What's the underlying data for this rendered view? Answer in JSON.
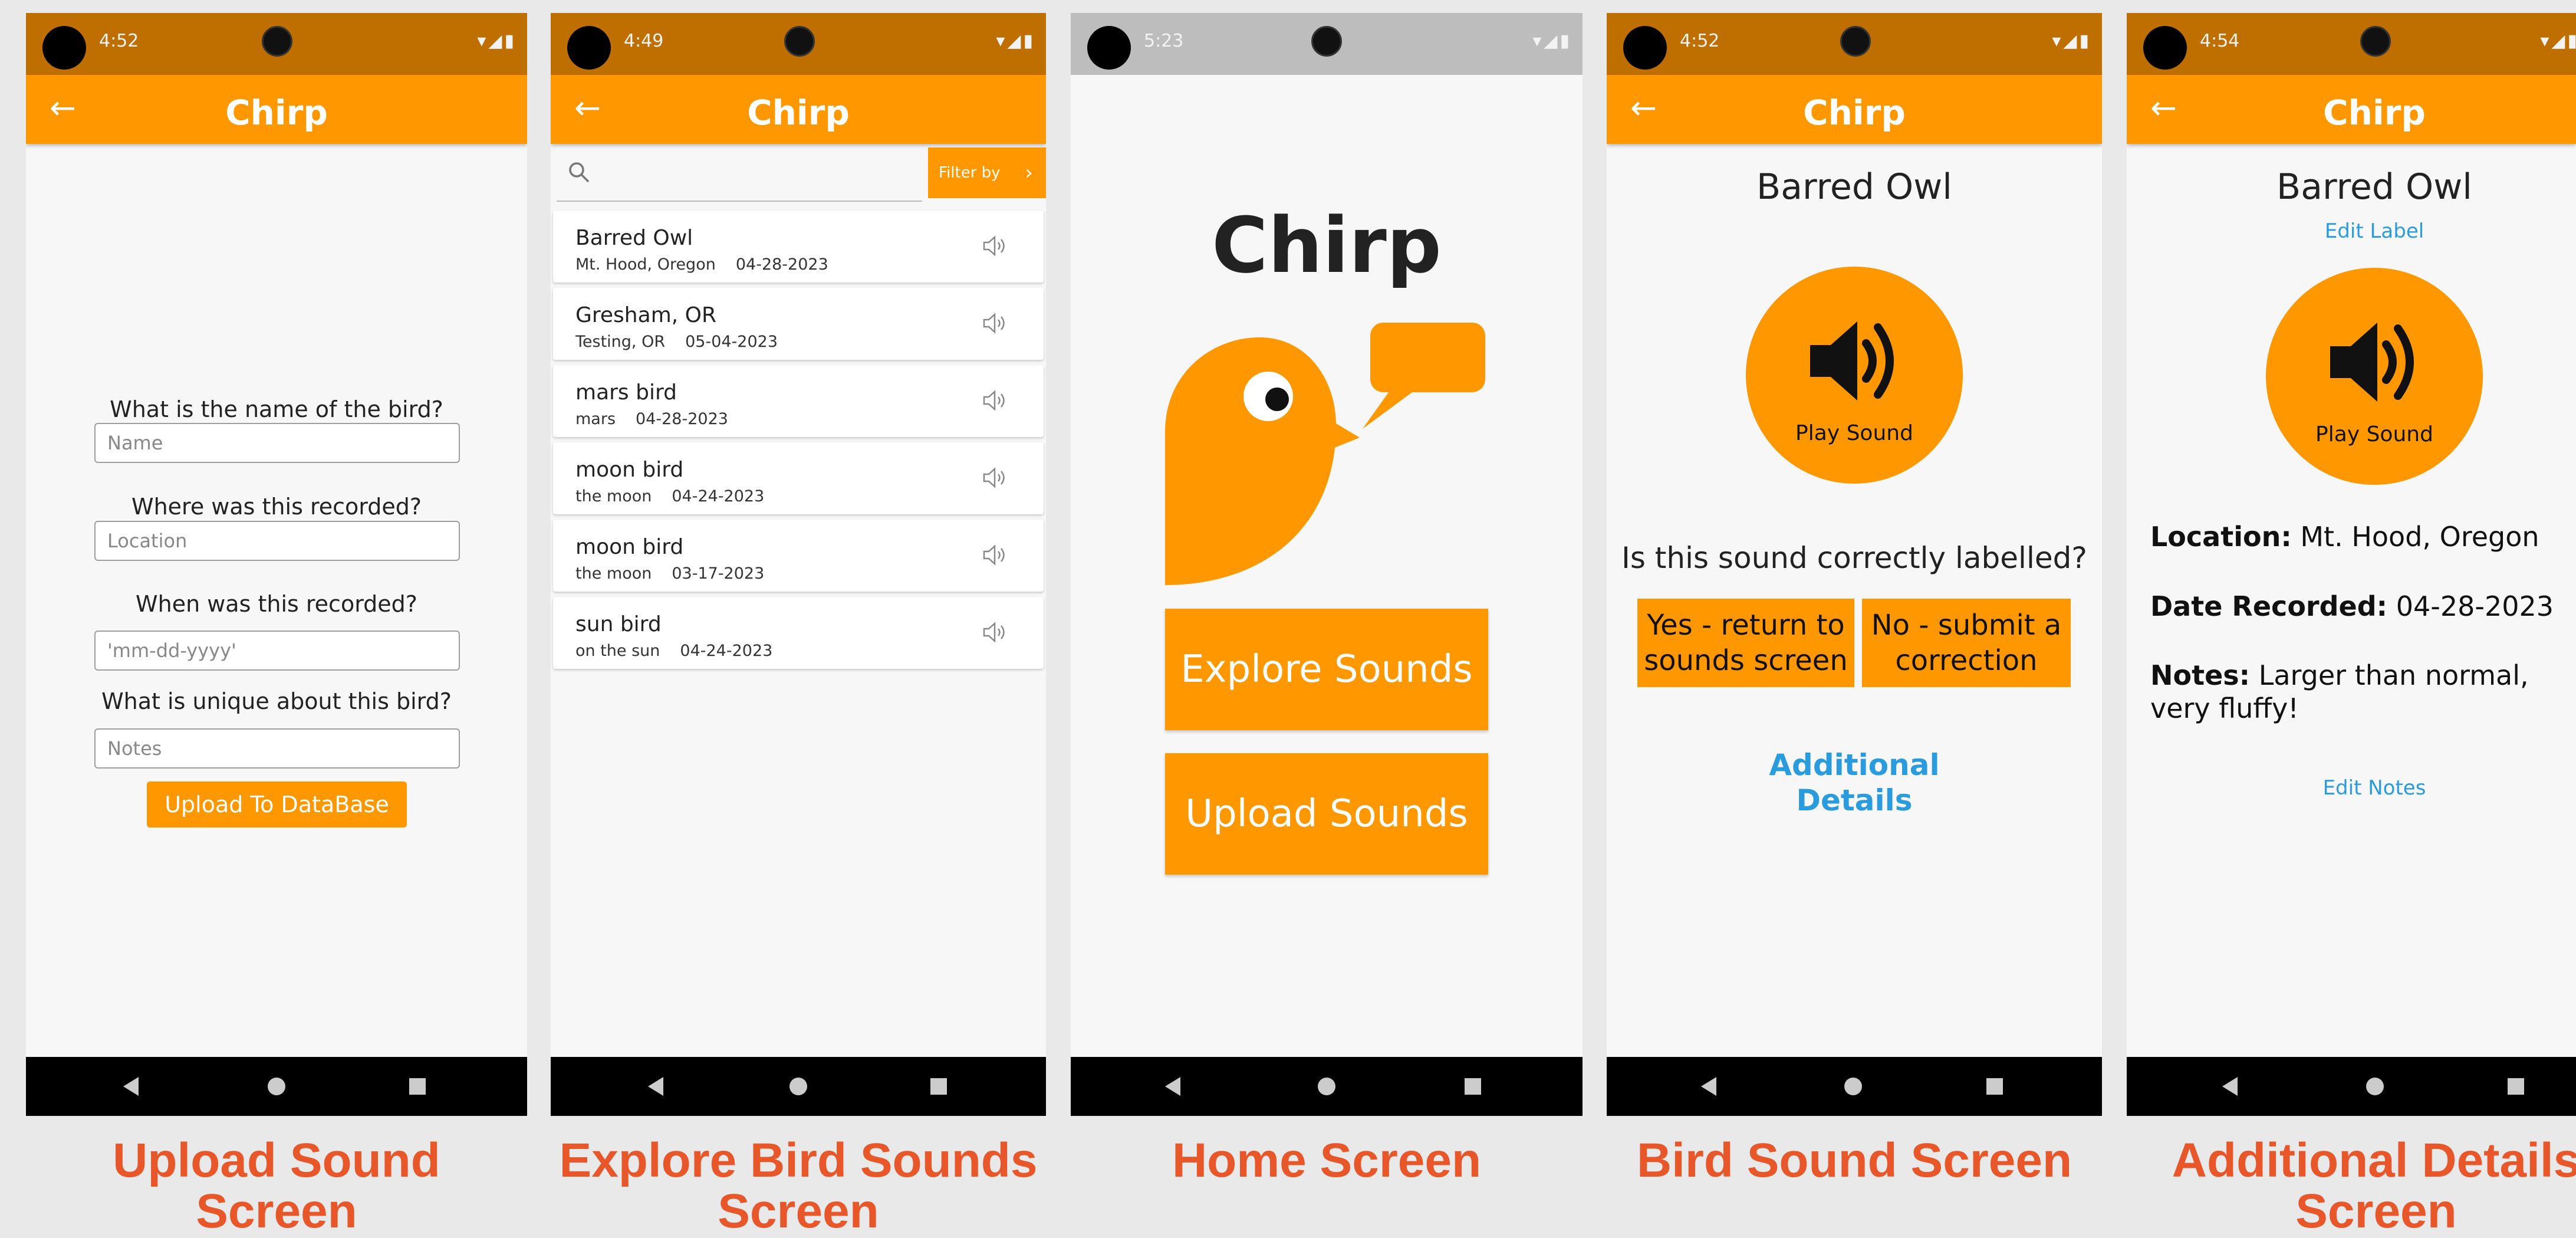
{
  "app": {
    "title": "Chirp",
    "back_glyph": "←",
    "accent_color": "#ff9800",
    "status_color": "#bf6f00",
    "link_color": "#2a9cdd",
    "caption_color": "#e8572a"
  },
  "screens": {
    "upload": {
      "time": "4:52",
      "questions": {
        "name": "What is the name of the bird?",
        "location": "Where was this recorded?",
        "date": "When was this recorded?",
        "unique": "What is unique about this bird?"
      },
      "placeholders": {
        "name": "Name",
        "location": "Location",
        "date": "'mm-dd-yyyy'",
        "notes": "Notes"
      },
      "submit_label": "Upload To DataBase",
      "caption_line1": "Upload Sound",
      "caption_line2": "Screen"
    },
    "explore": {
      "time": "4:49",
      "filter_label": "Filter by",
      "items": [
        {
          "title": "Barred Owl",
          "location": "Mt. Hood, Oregon",
          "date": "04-28-2023"
        },
        {
          "title": "Gresham, OR",
          "location": "Testing, OR",
          "date": "05-04-2023"
        },
        {
          "title": "mars bird",
          "location": "mars",
          "date": "04-28-2023"
        },
        {
          "title": "moon bird",
          "location": "the moon",
          "date": "04-24-2023"
        },
        {
          "title": "moon bird",
          "location": "the moon",
          "date": "03-17-2023"
        },
        {
          "title": "sun bird",
          "location": "on the sun",
          "date": "04-24-2023"
        }
      ],
      "caption_line1": "Explore Bird Sounds",
      "caption_line2": "Screen"
    },
    "home": {
      "time": "5:23",
      "heading": "Chirp",
      "explore_label": "Explore Sounds",
      "upload_label": "Upload Sounds",
      "caption": "Home Screen"
    },
    "bird_sound": {
      "time": "4:52",
      "bird_name": "Barred Owl",
      "play_label": "Play Sound",
      "question": "Is this sound correctly labelled?",
      "yes_line1": "Yes - return to",
      "yes_line2": "sounds screen",
      "no_line1": "No - submit a",
      "no_line2": "correction",
      "details_line1": "Additional",
      "details_line2": "Details",
      "caption": "Bird Sound Screen"
    },
    "details": {
      "time": "4:54",
      "bird_name": "Barred Owl",
      "edit_label": "Edit Label",
      "play_label": "Play Sound",
      "location_key": "Location:",
      "location_value": "Mt. Hood, Oregon",
      "date_key": "Date Recorded:",
      "date_value": "04-28-2023",
      "notes_key": "Notes:",
      "notes_value": "Larger than normal, very fluffy!",
      "edit_notes": "Edit Notes",
      "caption_line1": "Additional Details",
      "caption_line2": "Screen"
    }
  }
}
